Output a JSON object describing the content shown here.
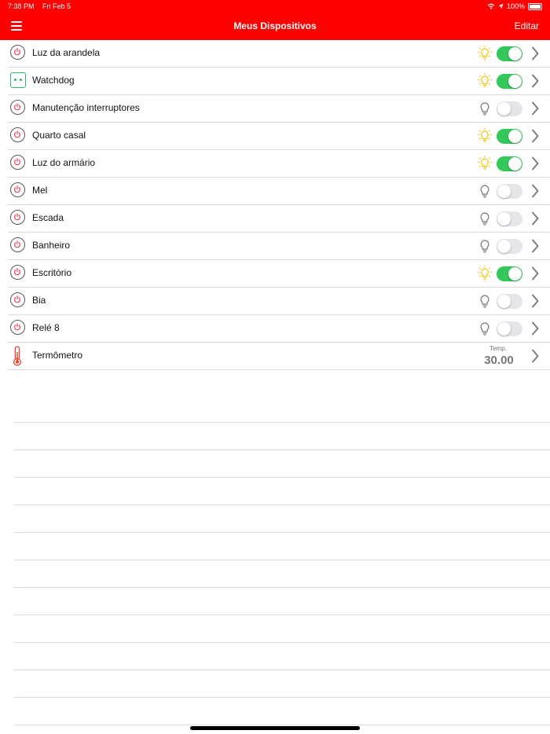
{
  "status_bar": {
    "time": "7:38 PM",
    "date": "Fri Feb 5",
    "battery": "100%",
    "icons": [
      "wifi-icon",
      "location-icon",
      "battery-icon"
    ]
  },
  "nav": {
    "title": "Meus Dispositivos",
    "edit_label": "Editar",
    "menu_icon": "hamburger-menu-icon"
  },
  "colors": {
    "accent": "#ff0000",
    "toggle_on": "#34c759",
    "bulb_on": "#f5c518",
    "bulb_off": "#777777",
    "thermometer": "#e8442e",
    "watchdog": "#2fb36a"
  },
  "devices": [
    {
      "label": "Luz da arandela",
      "icon": "power-icon",
      "on": true
    },
    {
      "label": "Watchdog",
      "icon": "watchdog-icon",
      "on": true
    },
    {
      "label": "Manutenção interruptores",
      "icon": "power-icon",
      "on": false
    },
    {
      "label": "Quarto casal",
      "icon": "power-icon",
      "on": true
    },
    {
      "label": "Luz do armário",
      "icon": "power-icon",
      "on": true
    },
    {
      "label": "Mel",
      "icon": "power-icon",
      "on": false
    },
    {
      "label": "Escada",
      "icon": "power-icon",
      "on": false
    },
    {
      "label": "Banheiro",
      "icon": "power-icon",
      "on": false
    },
    {
      "label": "Escritório",
      "icon": "power-icon",
      "on": true
    },
    {
      "label": "Bia",
      "icon": "power-icon",
      "on": false
    },
    {
      "label": "Relé 8",
      "icon": "power-icon",
      "on": false
    }
  ],
  "thermometer": {
    "label": "Termômetro",
    "icon": "thermometer-icon",
    "caption": "Temp.",
    "value": "30.00"
  }
}
